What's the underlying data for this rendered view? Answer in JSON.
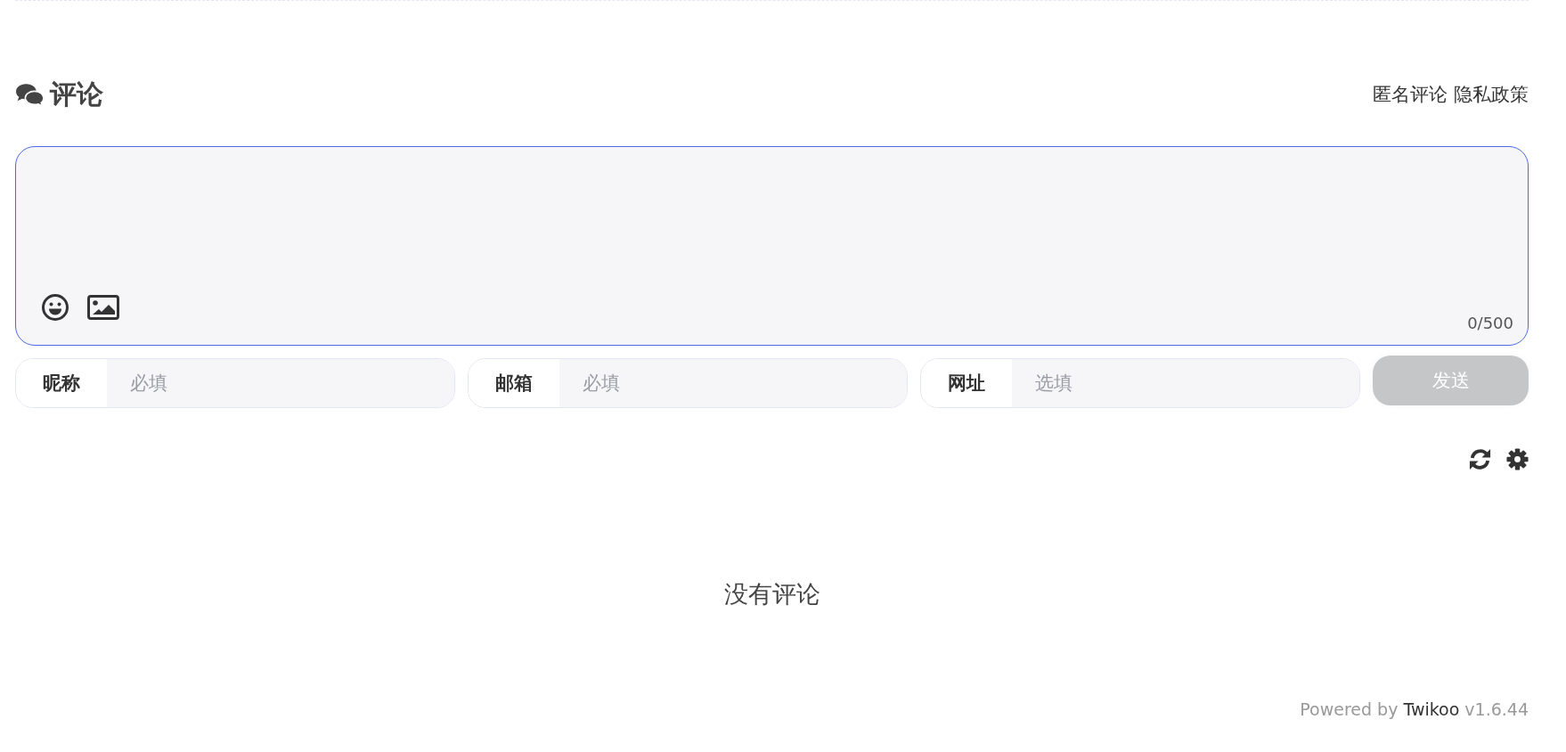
{
  "header": {
    "title": "评论",
    "links": [
      "匿名评论",
      "隐私政策"
    ]
  },
  "editor": {
    "counter": "0/500",
    "focused": true
  },
  "fields": [
    {
      "label": "昵称",
      "placeholder": "必填"
    },
    {
      "label": "邮箱",
      "placeholder": "必填"
    },
    {
      "label": "网址",
      "placeholder": "选填"
    }
  ],
  "send_button": {
    "label": "发送",
    "disabled": true
  },
  "empty_message": "没有评论",
  "footer": {
    "prefix": "Powered by ",
    "link": "Twikoo",
    "suffix": " v1.6.44"
  }
}
